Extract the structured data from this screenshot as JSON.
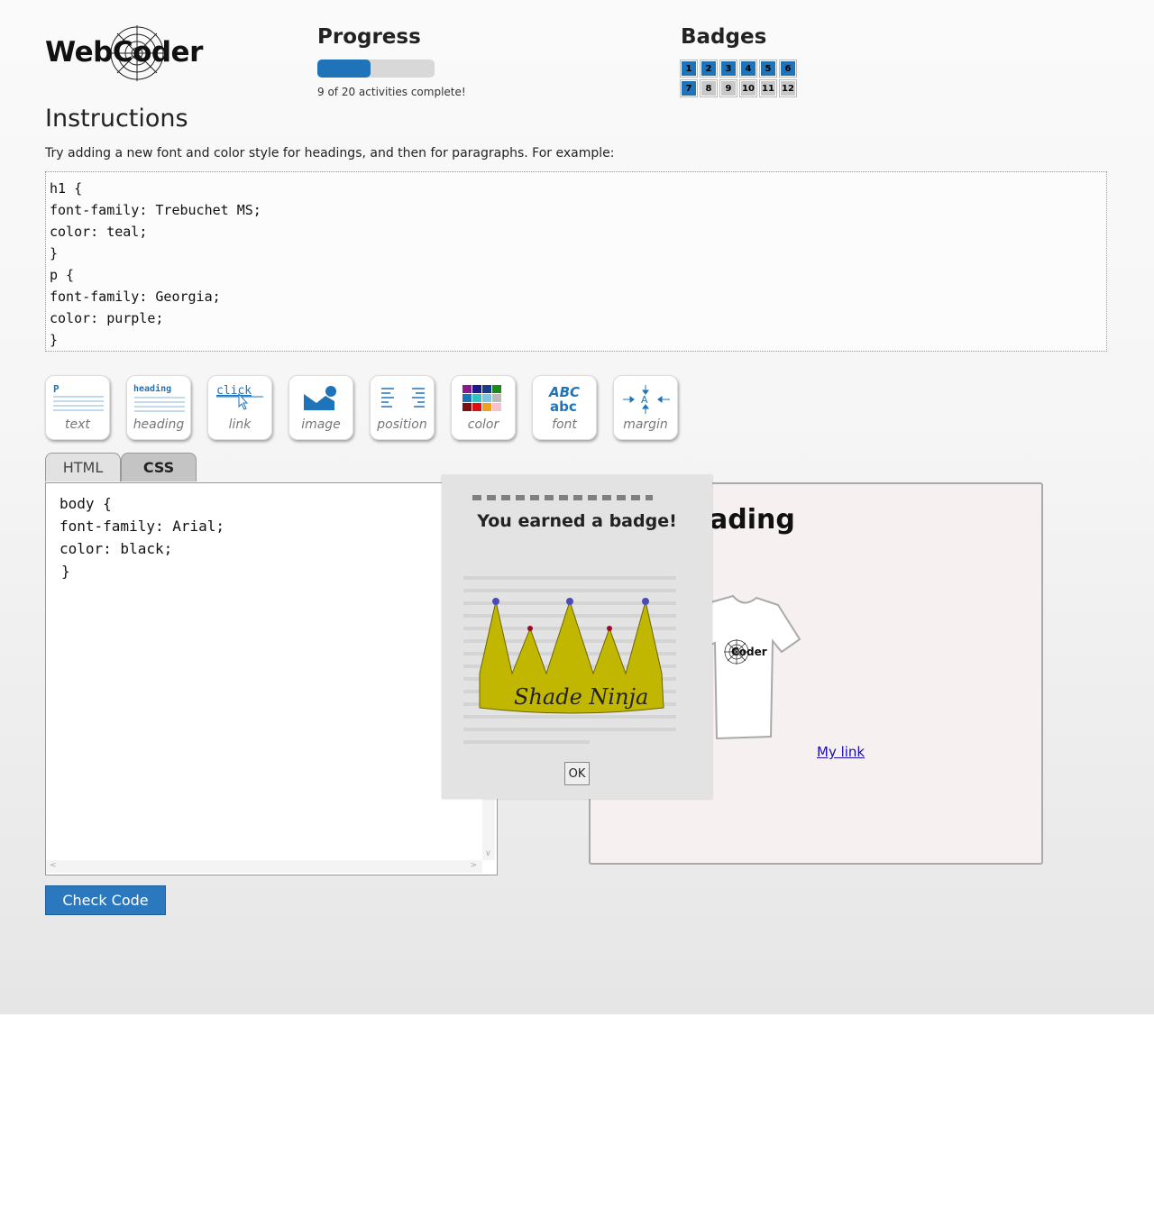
{
  "logo": {
    "text_web": "Web",
    "text_coder": "Coder"
  },
  "progress": {
    "title": "Progress",
    "completed": 9,
    "total": 20,
    "fraction": 0.45,
    "status_text": "9 of 20 activities complete!"
  },
  "badges": {
    "title": "Badges",
    "items": [
      {
        "label": "1",
        "earned": true
      },
      {
        "label": "2",
        "earned": true
      },
      {
        "label": "3",
        "earned": true
      },
      {
        "label": "4",
        "earned": true
      },
      {
        "label": "5",
        "earned": true
      },
      {
        "label": "6",
        "earned": true
      },
      {
        "label": "7",
        "earned": true
      },
      {
        "label": "8",
        "earned": false
      },
      {
        "label": "9",
        "earned": false
      },
      {
        "label": "10",
        "earned": false
      },
      {
        "label": "11",
        "earned": false
      },
      {
        "label": "12",
        "earned": false
      }
    ]
  },
  "instructions": {
    "title": "Instructions",
    "text": "Try adding a new font and color style for headings, and then for paragraphs. For example:",
    "code_lines": [
      "h1 {",
      "font-family: Trebuchet MS;",
      "color: teal;",
      "}",
      "p {",
      "font-family: Georgia;",
      "color: purple;",
      "}"
    ]
  },
  "tools": [
    {
      "label": "text",
      "glyph": "P"
    },
    {
      "label": "heading",
      "glyph": "heading"
    },
    {
      "label": "link",
      "glyph": "click"
    },
    {
      "label": "image"
    },
    {
      "label": "position"
    },
    {
      "label": "color"
    },
    {
      "label": "font",
      "glyph_top": "ABC",
      "glyph_bottom": "abc"
    },
    {
      "label": "margin",
      "glyph": "A"
    }
  ],
  "tabs": {
    "html": "HTML",
    "css": "CSS"
  },
  "editor": {
    "lines": [
      "body {",
      "font-family: Arial;",
      "color: black;",
      "}"
    ]
  },
  "check_button": "Check Code",
  "preview": {
    "heading_visible": "ading",
    "link": "My link",
    "shirt_logo": "Coder"
  },
  "modal": {
    "title": "You earned a badge!",
    "badge_name": "Shade Ninja",
    "ok": "OK"
  },
  "colors": {
    "accent": "#1f73b8",
    "badge_gold": "#c2b700",
    "link": "#1a0dab"
  }
}
